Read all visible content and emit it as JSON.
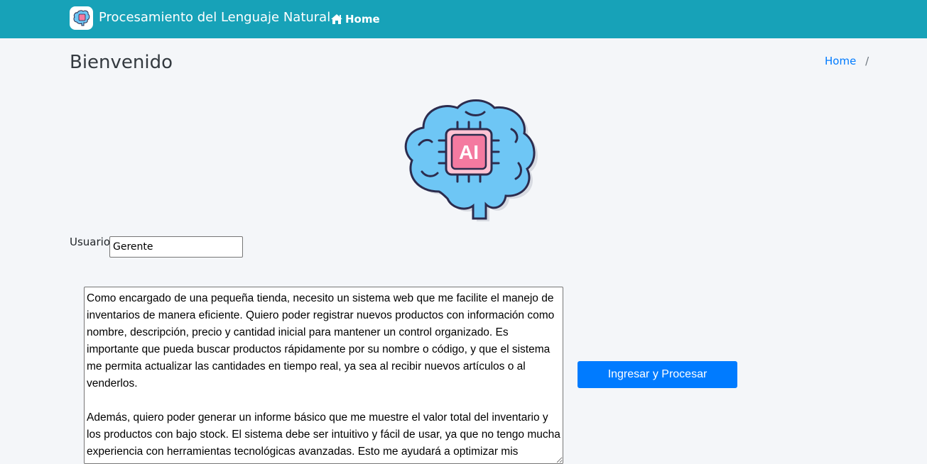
{
  "navbar": {
    "brand_text": "Procesamiento del Lenguaje Natural",
    "home_label": "Home",
    "bg_color": "#17a2b8"
  },
  "header": {
    "title": "Bienvenido",
    "breadcrumb": [
      {
        "label": "Home"
      }
    ],
    "breadcrumb_separator": "/"
  },
  "hero": {
    "icon": "ai-brain-icon",
    "chip_text": "AI"
  },
  "form": {
    "user_label": "Usuario:",
    "user_value": "Gerente",
    "story_text": "Como encargado de una pequeña tienda, necesito un sistema web que me facilite el manejo de inventarios de manera eficiente. Quiero poder registrar nuevos productos con información como nombre, descripción, precio y cantidad inicial para mantener un control organizado. Es importante que pueda buscar productos rápidamente por su nombre o código, y que el sistema me permita actualizar las cantidades en tiempo real, ya sea al recibir nuevos artículos o al venderlos.\n\nAdemás, quiero poder generar un informe básico que me muestre el valor total del inventario y los productos con bajo stock. El sistema debe ser intuitivo y fácil de usar, ya que no tengo mucha experiencia con herramientas tecnológicas avanzadas. Esto me ayudará a optimizar mis operaciones diarias y evitar errores en el manejo de existencias.",
    "submit_label": "Ingresar y Procesar",
    "submit_color": "#007bff"
  }
}
